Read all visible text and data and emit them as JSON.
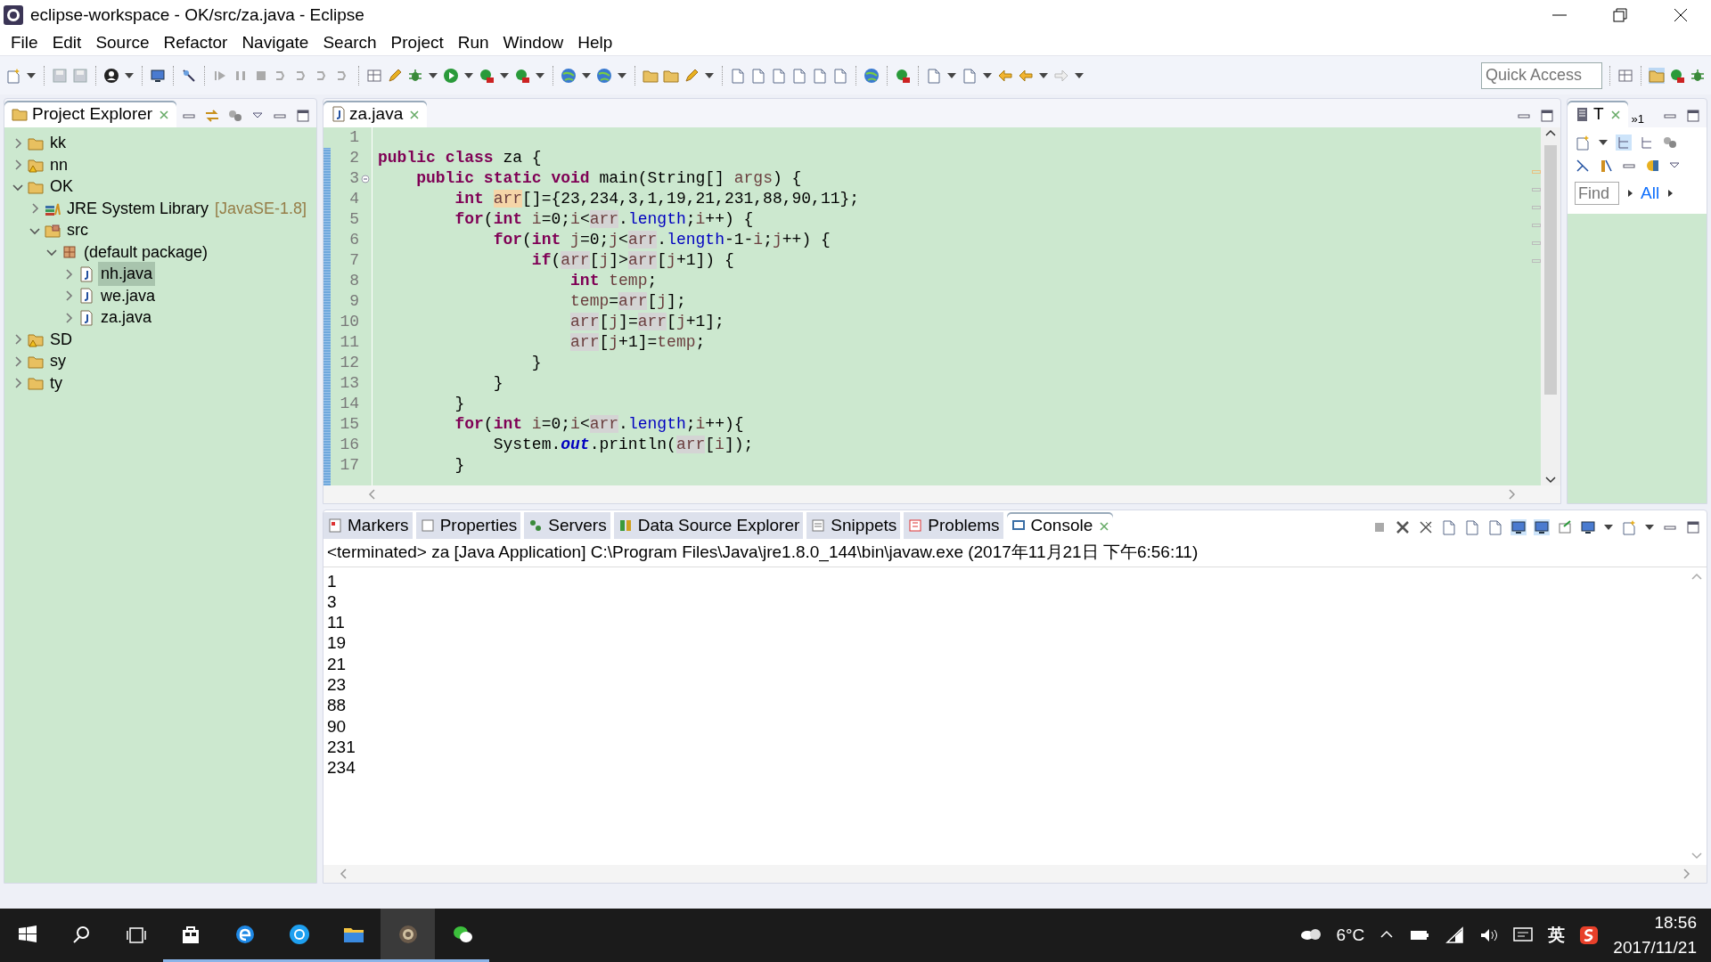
{
  "window": {
    "title": "eclipse-workspace - OK/src/za.java - Eclipse"
  },
  "menu": [
    "File",
    "Edit",
    "Source",
    "Refactor",
    "Navigate",
    "Search",
    "Project",
    "Run",
    "Window",
    "Help"
  ],
  "quick_access": {
    "placeholder": "Quick Access"
  },
  "project_explorer": {
    "title": "Project Explorer",
    "items": [
      {
        "label": "kk",
        "kind": "project",
        "expanded": false,
        "selected": false
      },
      {
        "label": "nn",
        "kind": "project-warning",
        "expanded": false,
        "selected": false
      },
      {
        "label": "OK",
        "kind": "project",
        "expanded": true,
        "selected": false,
        "children": [
          {
            "label": "JRE System Library",
            "decoration": "[JavaSE-1.8]",
            "kind": "library",
            "expanded": false,
            "selected": false
          },
          {
            "label": "src",
            "kind": "source-folder",
            "expanded": true,
            "selected": false,
            "children": [
              {
                "label": "(default package)",
                "kind": "package",
                "expanded": true,
                "selected": false,
                "children": [
                  {
                    "label": "nh.java",
                    "kind": "java-file",
                    "expanded": false,
                    "selected": true
                  },
                  {
                    "label": "we.java",
                    "kind": "java-file",
                    "expanded": false,
                    "selected": false
                  },
                  {
                    "label": "za.java",
                    "kind": "java-file",
                    "expanded": false,
                    "selected": false
                  }
                ]
              }
            ]
          }
        ]
      },
      {
        "label": "SD",
        "kind": "project-warning",
        "expanded": false,
        "selected": false
      },
      {
        "label": "sy",
        "kind": "project",
        "expanded": false,
        "selected": false
      },
      {
        "label": "ty",
        "kind": "project",
        "expanded": false,
        "selected": false
      }
    ]
  },
  "editor": {
    "tabs": [
      {
        "label": "za.java",
        "selected": true
      }
    ],
    "lines": [
      {
        "number": "1",
        "fold": false
      },
      {
        "number": "2",
        "fold": false,
        "tokens": [
          {
            "kind": "keyword",
            "text": "public"
          },
          {
            "kind": "keyword",
            "text": " class"
          },
          {
            "kind": "plain",
            "text": " za {"
          }
        ]
      },
      {
        "number": "3",
        "fold": true,
        "tokens": [
          {
            "kind": "keyword",
            "text": "    public"
          },
          {
            "kind": "keyword",
            "text": " static"
          },
          {
            "kind": "keyword",
            "text": " void"
          },
          {
            "kind": "plain",
            "text": " main(String[] "
          },
          {
            "kind": "variable",
            "text": "args"
          },
          {
            "kind": "plain",
            "text": ") {"
          }
        ]
      },
      {
        "number": "4",
        "fold": false,
        "tokens": [
          {
            "kind": "keyword",
            "text": "        int"
          },
          {
            "kind": "marked",
            "text": " arr"
          },
          {
            "kind": "plain",
            "text": "[]={23,234,3,1,19,21,231,88,90,11};"
          }
        ]
      },
      {
        "number": "5",
        "fold": false,
        "tokens": [
          {
            "kind": "keyword",
            "text": "        for"
          },
          {
            "kind": "plain",
            "text": "("
          },
          {
            "kind": "keyword",
            "text": "int"
          },
          {
            "kind": "variable",
            "text": " i"
          },
          {
            "kind": "plain",
            "text": "=0;"
          },
          {
            "kind": "variable",
            "text": "i"
          },
          {
            "kind": "plain",
            "text": "<"
          },
          {
            "kind": "occurrence",
            "text": "arr"
          },
          {
            "kind": "plain",
            "text": "."
          },
          {
            "kind": "field",
            "text": "length"
          },
          {
            "kind": "plain",
            "text": ";"
          },
          {
            "kind": "variable",
            "text": "i"
          },
          {
            "kind": "plain",
            "text": "++) {"
          }
        ]
      },
      {
        "number": "6",
        "fold": false,
        "tokens": [
          {
            "kind": "keyword",
            "text": "            for"
          },
          {
            "kind": "plain",
            "text": "("
          },
          {
            "kind": "keyword",
            "text": "int"
          },
          {
            "kind": "variable",
            "text": " j"
          },
          {
            "kind": "plain",
            "text": "=0;"
          },
          {
            "kind": "variable",
            "text": "j"
          },
          {
            "kind": "plain",
            "text": "<"
          },
          {
            "kind": "occurrence",
            "text": "arr"
          },
          {
            "kind": "plain",
            "text": "."
          },
          {
            "kind": "field",
            "text": "length"
          },
          {
            "kind": "plain",
            "text": "-1-"
          },
          {
            "kind": "variable",
            "text": "i"
          },
          {
            "kind": "plain",
            "text": ";"
          },
          {
            "kind": "variable",
            "text": "j"
          },
          {
            "kind": "plain",
            "text": "++) {"
          }
        ]
      },
      {
        "number": "7",
        "fold": false,
        "tokens": [
          {
            "kind": "keyword",
            "text": "                if"
          },
          {
            "kind": "plain",
            "text": "("
          },
          {
            "kind": "occurrence",
            "text": "arr"
          },
          {
            "kind": "plain",
            "text": "["
          },
          {
            "kind": "variable",
            "text": "j"
          },
          {
            "kind": "plain",
            "text": "]>"
          },
          {
            "kind": "occurrence",
            "text": "arr"
          },
          {
            "kind": "plain",
            "text": "["
          },
          {
            "kind": "variable",
            "text": "j"
          },
          {
            "kind": "plain",
            "text": "+1]) {"
          }
        ]
      },
      {
        "number": "8",
        "fold": false,
        "tokens": [
          {
            "kind": "keyword",
            "text": "                    int"
          },
          {
            "kind": "variable",
            "text": " temp"
          },
          {
            "kind": "plain",
            "text": ";"
          }
        ]
      },
      {
        "number": "9",
        "fold": false,
        "tokens": [
          {
            "kind": "variable",
            "text": "                    temp"
          },
          {
            "kind": "plain",
            "text": "="
          },
          {
            "kind": "occurrence",
            "text": "arr"
          },
          {
            "kind": "plain",
            "text": "["
          },
          {
            "kind": "variable",
            "text": "j"
          },
          {
            "kind": "plain",
            "text": "];"
          }
        ]
      },
      {
        "number": "10",
        "fold": false,
        "tokens": [
          {
            "kind": "occurrence",
            "text": "                    arr"
          },
          {
            "kind": "plain",
            "text": "["
          },
          {
            "kind": "variable",
            "text": "j"
          },
          {
            "kind": "plain",
            "text": "]="
          },
          {
            "kind": "occurrence",
            "text": "arr"
          },
          {
            "kind": "plain",
            "text": "["
          },
          {
            "kind": "variable",
            "text": "j"
          },
          {
            "kind": "plain",
            "text": "+1];"
          }
        ]
      },
      {
        "number": "11",
        "fold": false,
        "tokens": [
          {
            "kind": "occurrence",
            "text": "                    arr"
          },
          {
            "kind": "plain",
            "text": "["
          },
          {
            "kind": "variable",
            "text": "j"
          },
          {
            "kind": "plain",
            "text": "+1]="
          },
          {
            "kind": "variable",
            "text": "temp"
          },
          {
            "kind": "plain",
            "text": ";"
          }
        ]
      },
      {
        "number": "12",
        "fold": false,
        "tokens": [
          {
            "kind": "plain",
            "text": "                }"
          }
        ]
      },
      {
        "number": "13",
        "fold": false,
        "tokens": [
          {
            "kind": "plain",
            "text": "            }"
          }
        ]
      },
      {
        "number": "14",
        "fold": false,
        "tokens": [
          {
            "kind": "plain",
            "text": "        }"
          }
        ]
      },
      {
        "number": "15",
        "fold": false,
        "tokens": [
          {
            "kind": "keyword",
            "text": "        for"
          },
          {
            "kind": "plain",
            "text": "("
          },
          {
            "kind": "keyword",
            "text": "int"
          },
          {
            "kind": "variable",
            "text": " i"
          },
          {
            "kind": "plain",
            "text": "=0;"
          },
          {
            "kind": "variable",
            "text": "i"
          },
          {
            "kind": "plain",
            "text": "<"
          },
          {
            "kind": "occurrence",
            "text": "arr"
          },
          {
            "kind": "plain",
            "text": "."
          },
          {
            "kind": "field",
            "text": "length"
          },
          {
            "kind": "plain",
            "text": ";"
          },
          {
            "kind": "variable",
            "text": "i"
          },
          {
            "kind": "plain",
            "text": "++){"
          }
        ]
      },
      {
        "number": "16",
        "fold": false,
        "tokens": [
          {
            "kind": "plain",
            "text": "            System."
          },
          {
            "kind": "static-field",
            "text": "out"
          },
          {
            "kind": "plain",
            "text": ".println("
          },
          {
            "kind": "occurrence",
            "text": "arr"
          },
          {
            "kind": "plain",
            "text": "["
          },
          {
            "kind": "variable",
            "text": "i"
          },
          {
            "kind": "plain",
            "text": "]);"
          }
        ]
      },
      {
        "number": "17",
        "fold": false,
        "tokens": [
          {
            "kind": "plain",
            "text": "        }"
          }
        ]
      }
    ]
  },
  "outline": {
    "title": "T",
    "overflow": "»1",
    "find": {
      "placeholder": "Find"
    },
    "filter": "All"
  },
  "console": {
    "tabs": [
      {
        "label": "Markers",
        "selected": false
      },
      {
        "label": "Properties",
        "selected": false
      },
      {
        "label": "Servers",
        "selected": false
      },
      {
        "label": "Data Source Explorer",
        "selected": false
      },
      {
        "label": "Snippets",
        "selected": false
      },
      {
        "label": "Problems",
        "selected": false
      },
      {
        "label": "Console",
        "selected": true
      }
    ],
    "status": "<terminated> za [Java Application] C:\\Program Files\\Java\\jre1.8.0_144\\bin\\javaw.exe (2017年11月21日 下午6:56:11)",
    "output": [
      "1",
      "3",
      "11",
      "19",
      "21",
      "23",
      "88",
      "90",
      "231",
      "234"
    ]
  },
  "taskbar": {
    "weather": "6°C",
    "ime": "英",
    "time": "18:56",
    "date": "2017/11/21"
  }
}
